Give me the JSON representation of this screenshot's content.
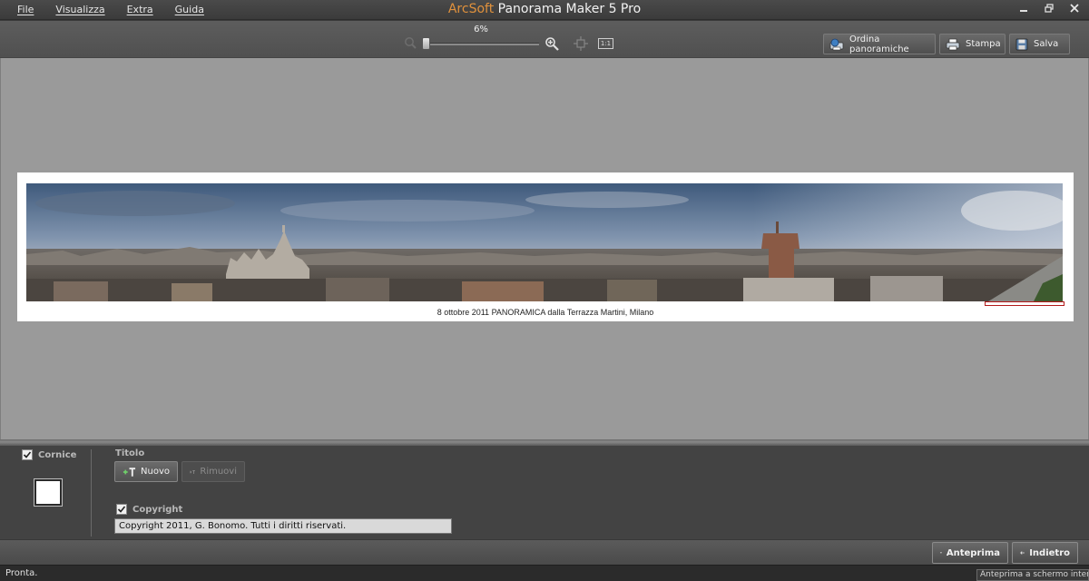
{
  "menu": [
    "File",
    "Visualizza",
    "Extra",
    "Guida"
  ],
  "title": {
    "brand": "ArcSoft",
    "product": "Panorama Maker 5 Pro"
  },
  "window_controls": [
    "minimize-icon",
    "restore-icon",
    "close-icon"
  ],
  "toolbar": {
    "zoom_percent": "6%",
    "zoom_level": 0.06,
    "actual_size_label": "1:1",
    "order_label": "Ordina panoramiche",
    "print_label": "Stampa",
    "save_label": "Salva"
  },
  "canvas": {
    "caption": "8 ottobre 2011 PANORAMICA dalla Terrazza Martini, Milano"
  },
  "panel": {
    "frame_label": "Cornice",
    "frame_checked": true,
    "frame_color": "#ffffff",
    "title_section": "Titolo",
    "new_label": "Nuovo",
    "remove_label": "Rimuovi",
    "copyright_label": "Copyright",
    "copyright_checked": true,
    "copyright_value": "Copyright 2011, G. Bonomo. Tutti i diritti riservati."
  },
  "footer": {
    "preview_label": "Anteprima",
    "back_label": "Indietro"
  },
  "status": {
    "text": "Pronta.",
    "tooltip": "Anteprima a schermo intero"
  },
  "colors": {
    "brand_accent": "#e0913c",
    "workarea_bg": "#9a9a9a",
    "panel_bg": "#434343"
  }
}
